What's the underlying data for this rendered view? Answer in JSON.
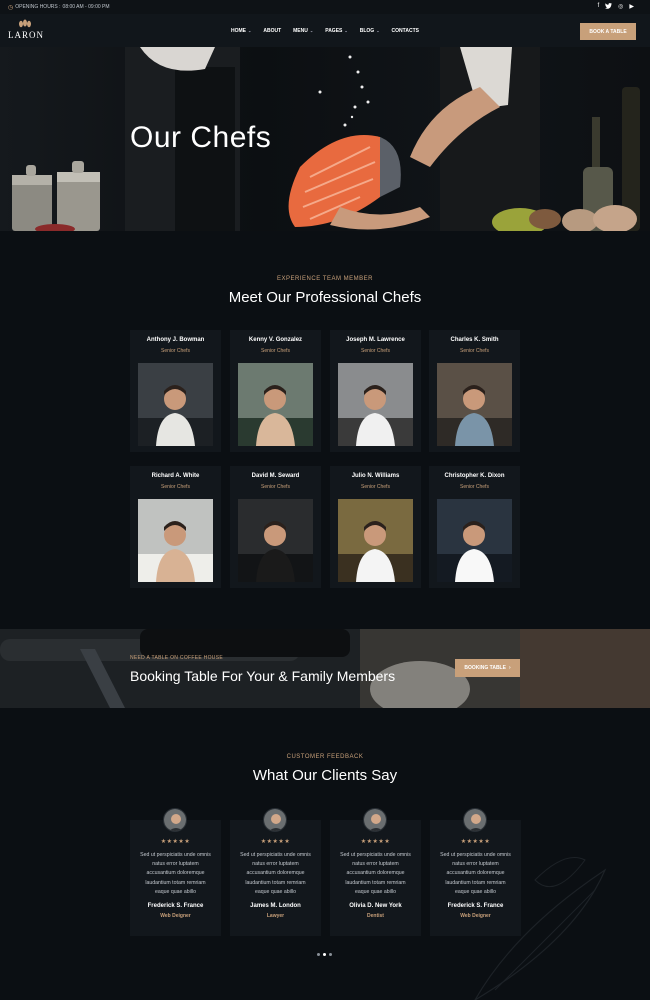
{
  "topbar": {
    "clock_icon": "clock-icon",
    "hours_label": "OPENING HOURS :",
    "hours_value": "08:00 AM - 09:00 PM",
    "socials": [
      {
        "icon": "facebook-icon",
        "glyph": "f"
      },
      {
        "icon": "twitter-icon",
        "glyph": "🐦"
      },
      {
        "icon": "instagram-icon",
        "glyph": "◎"
      },
      {
        "icon": "youtube-icon",
        "glyph": "▶"
      }
    ]
  },
  "brand": {
    "name": "LARON",
    "logo_icon": "coffee-beans-icon"
  },
  "nav": {
    "items": [
      {
        "label": "HOME",
        "dropdown": true
      },
      {
        "label": "ABOUT",
        "dropdown": false
      },
      {
        "label": "MENU",
        "dropdown": true
      },
      {
        "label": "PAGES",
        "dropdown": true
      },
      {
        "label": "BLOG",
        "dropdown": true
      },
      {
        "label": "CONTACTS",
        "dropdown": false
      }
    ],
    "cta": "BOOK A TABLE"
  },
  "hero": {
    "title": "Our Chefs"
  },
  "team": {
    "subtitle": "EXPERIENCE TEAM MEMBER",
    "title": "Meet Our Professional Chefs",
    "chefs": [
      {
        "name": "Anthony J. Bowman",
        "role": "Senior Chefs"
      },
      {
        "name": "Kenny V. Gonzalez",
        "role": "Senior Chefs"
      },
      {
        "name": "Joseph M. Lawrence",
        "role": "Senior Chefs"
      },
      {
        "name": "Charles K. Smith",
        "role": "Senior Chefs"
      },
      {
        "name": "Richard A. White",
        "role": "Senior Chefs"
      },
      {
        "name": "David M. Seward",
        "role": "Senior Chefs"
      },
      {
        "name": "Julio N. Williams",
        "role": "Senior Chefs"
      },
      {
        "name": "Christopher K. Dixon",
        "role": "Senior Chefs"
      }
    ]
  },
  "booking": {
    "subtitle": "NEED A TABLE ON COFFEE HOUSE",
    "title": "Booking Table For Your & Family Members",
    "button": "BOOKING TABLE",
    "button_icon": "chevron-right-icon"
  },
  "testimonials": {
    "subtitle": "CUSTOMER FEEDBACK",
    "title": "What Our Clients Say",
    "stars": "★★★★★",
    "items": [
      {
        "quote": "Sed ut perspiciatis unde omnis natus error luptatem accusantium doloremque laudantium totam remriam eaque quae abillo",
        "name": "Frederick S. France",
        "role": "Web Deigner"
      },
      {
        "quote": "Sed ut perspiciatis unde omnis natus error luptatem accusantium doloremque laudantium totam remriam eaque quae abillo",
        "name": "James M. London",
        "role": "Lawyer"
      },
      {
        "quote": "Sed ut perspiciatis unde omnis natus error luptatem accusantium doloremque laudantium totam remriam eaque quae abillo",
        "name": "Olivia D. New York",
        "role": "Dentist"
      },
      {
        "quote": "Sed ut perspiciatis unde omnis natus error luptatem accusantium doloremque laudantium totam remriam eaque quae abillo",
        "name": "Frederick S. France",
        "role": "Web Deigner"
      }
    ],
    "active_page": 2,
    "page_count": 3
  },
  "colors": {
    "accent": "#c8a07a",
    "background": "#0b0f13",
    "card": "#12171c"
  }
}
